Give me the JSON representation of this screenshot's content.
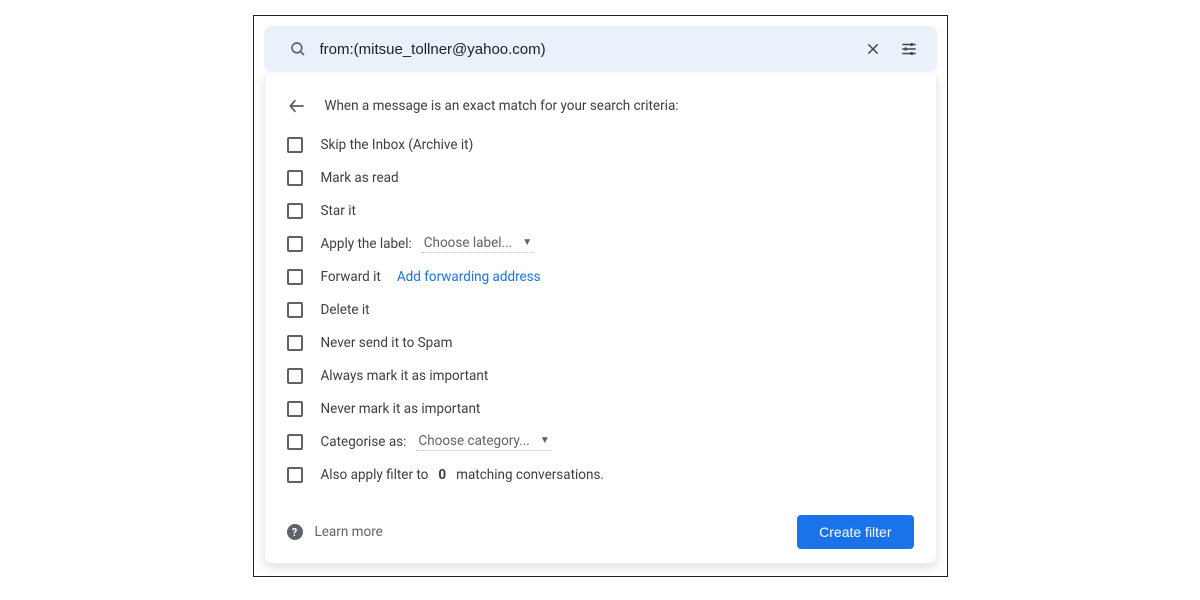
{
  "search": {
    "value": "from:(mitsue_tollner@yahoo.com)"
  },
  "panel": {
    "heading": "When a message is an exact match for your search criteria:"
  },
  "options": {
    "skip_inbox": "Skip the Inbox (Archive it)",
    "mark_read": "Mark as read",
    "star_it": "Star it",
    "apply_label_prefix": "Apply the label:",
    "apply_label_select": "Choose label...",
    "forward_it": "Forward it",
    "forward_link": "Add forwarding address",
    "delete_it": "Delete it",
    "never_spam": "Never send it to Spam",
    "always_important": "Always mark it as important",
    "never_important": "Never mark it as important",
    "categorise_prefix": "Categorise as:",
    "categorise_select": "Choose category...",
    "also_apply_pre": "Also apply filter to ",
    "also_apply_count": "0",
    "also_apply_post": " matching conversations."
  },
  "footer": {
    "learn_more": "Learn more",
    "create_filter": "Create filter"
  }
}
